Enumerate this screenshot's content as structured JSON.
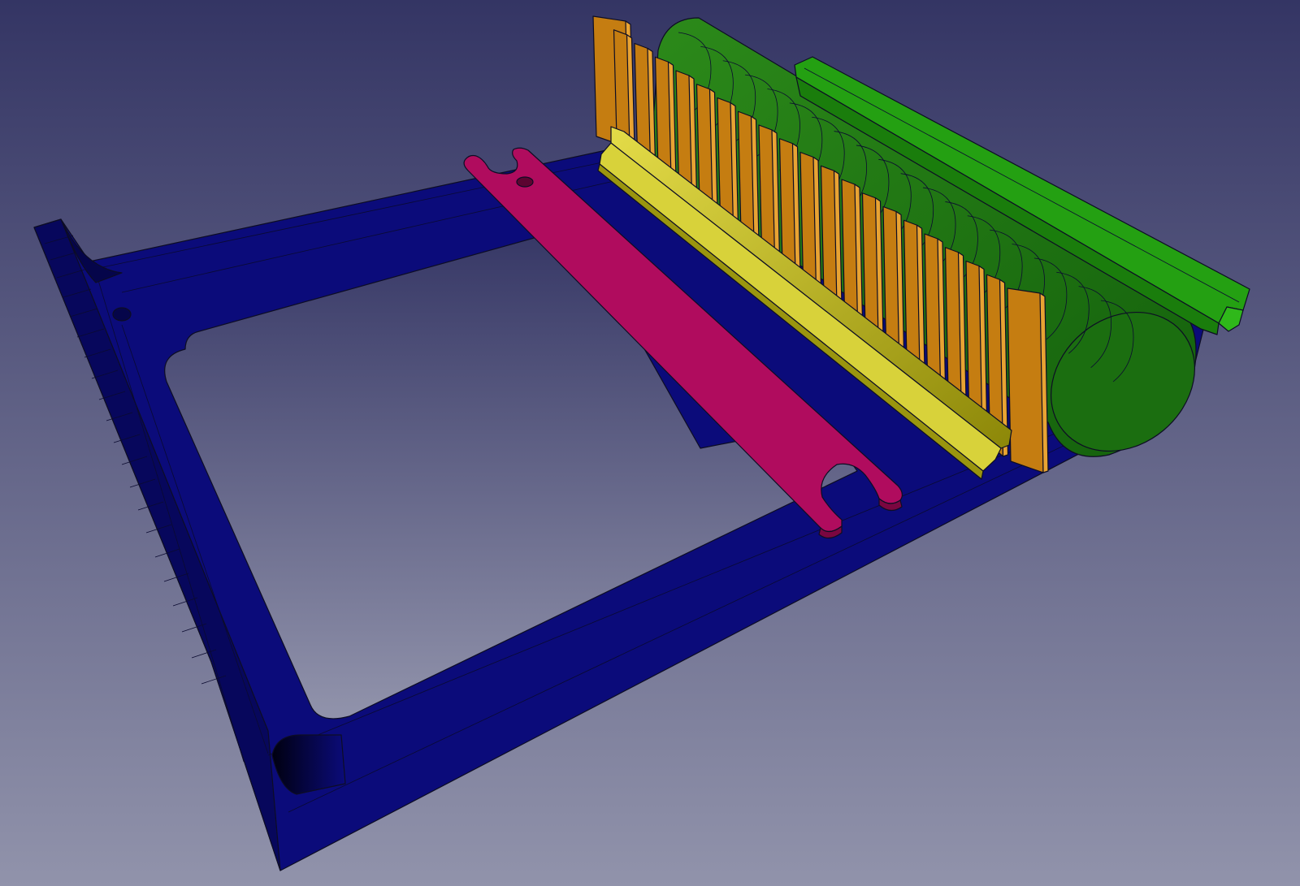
{
  "viewport": {
    "background_top": "#343564",
    "background_bottom": "#9193ab"
  },
  "parts": {
    "base_frame": {
      "color": "#0b0b7a"
    },
    "wrench_plate": {
      "color": "#b00c5e"
    },
    "angle_rail": {
      "color": "#c8c320"
    },
    "spacer_plates": {
      "color": "#c57d11",
      "count": 21
    },
    "cylinder_body": {
      "color": "#1f7a12"
    },
    "top_rail": {
      "color": "#24a012"
    }
  }
}
